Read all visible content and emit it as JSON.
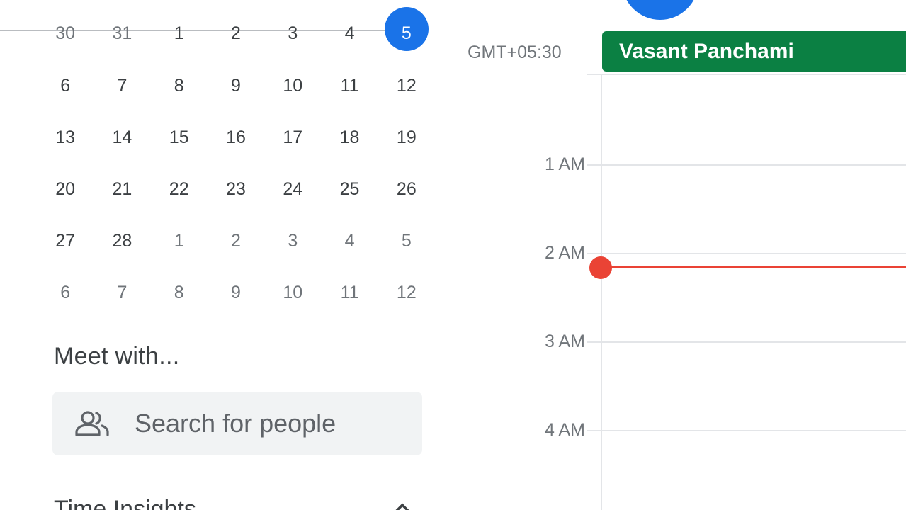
{
  "mini_calendar": {
    "weeks": [
      [
        "30",
        "31",
        "1",
        "2",
        "3",
        "4",
        "5"
      ],
      [
        "6",
        "7",
        "8",
        "9",
        "10",
        "11",
        "12"
      ],
      [
        "13",
        "14",
        "15",
        "16",
        "17",
        "18",
        "19"
      ],
      [
        "20",
        "21",
        "22",
        "23",
        "24",
        "25",
        "26"
      ],
      [
        "27",
        "28",
        "1",
        "2",
        "3",
        "4",
        "5"
      ],
      [
        "6",
        "7",
        "8",
        "9",
        "10",
        "11",
        "12"
      ]
    ],
    "selected_day": "5"
  },
  "meet_with": {
    "title": "Meet with...",
    "search_placeholder": "Search for people",
    "icon": "people-icon"
  },
  "time_insights": {
    "title": "Time Insights",
    "icon": "chevron-up-icon"
  },
  "day_view": {
    "timezone": "GMT+05:30",
    "all_day_event": "Vasant Panchami",
    "hours": [
      "1 AM",
      "2 AM",
      "3 AM",
      "4 AM"
    ],
    "current_time_color": "#ea4335"
  },
  "colors": {
    "accent": "#1a73e8",
    "event": "#0b8043",
    "now_indicator": "#ea4335"
  }
}
